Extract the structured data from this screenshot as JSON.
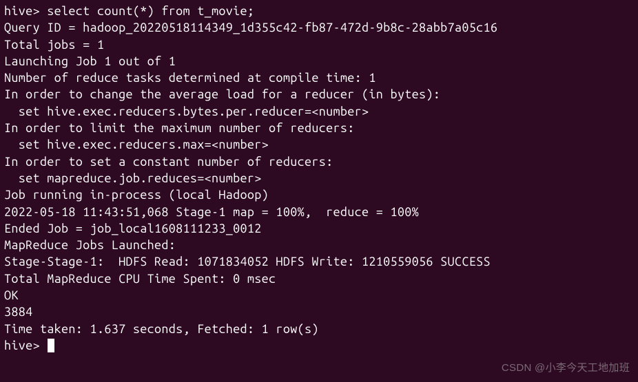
{
  "terminal": {
    "lines": [
      "hive> select count(*) from t_movie;",
      "Query ID = hadoop_20220518114349_1d355c42-fb87-472d-9b8c-28abb7a05c16",
      "Total jobs = 1",
      "Launching Job 1 out of 1",
      "Number of reduce tasks determined at compile time: 1",
      "In order to change the average load for a reducer (in bytes):",
      "  set hive.exec.reducers.bytes.per.reducer=<number>",
      "In order to limit the maximum number of reducers:",
      "  set hive.exec.reducers.max=<number>",
      "In order to set a constant number of reducers:",
      "  set mapreduce.job.reduces=<number>",
      "Job running in-process (local Hadoop)",
      "2022-05-18 11:43:51,068 Stage-1 map = 100%,  reduce = 100%",
      "Ended Job = job_local1608111233_0012",
      "MapReduce Jobs Launched:",
      "Stage-Stage-1:  HDFS Read: 1071834052 HDFS Write: 1210559056 SUCCESS",
      "Total MapReduce CPU Time Spent: 0 msec",
      "OK",
      "3884",
      "Time taken: 1.637 seconds, Fetched: 1 row(s)",
      "hive> "
    ]
  },
  "watermark": "CSDN @小李今天工地加班"
}
